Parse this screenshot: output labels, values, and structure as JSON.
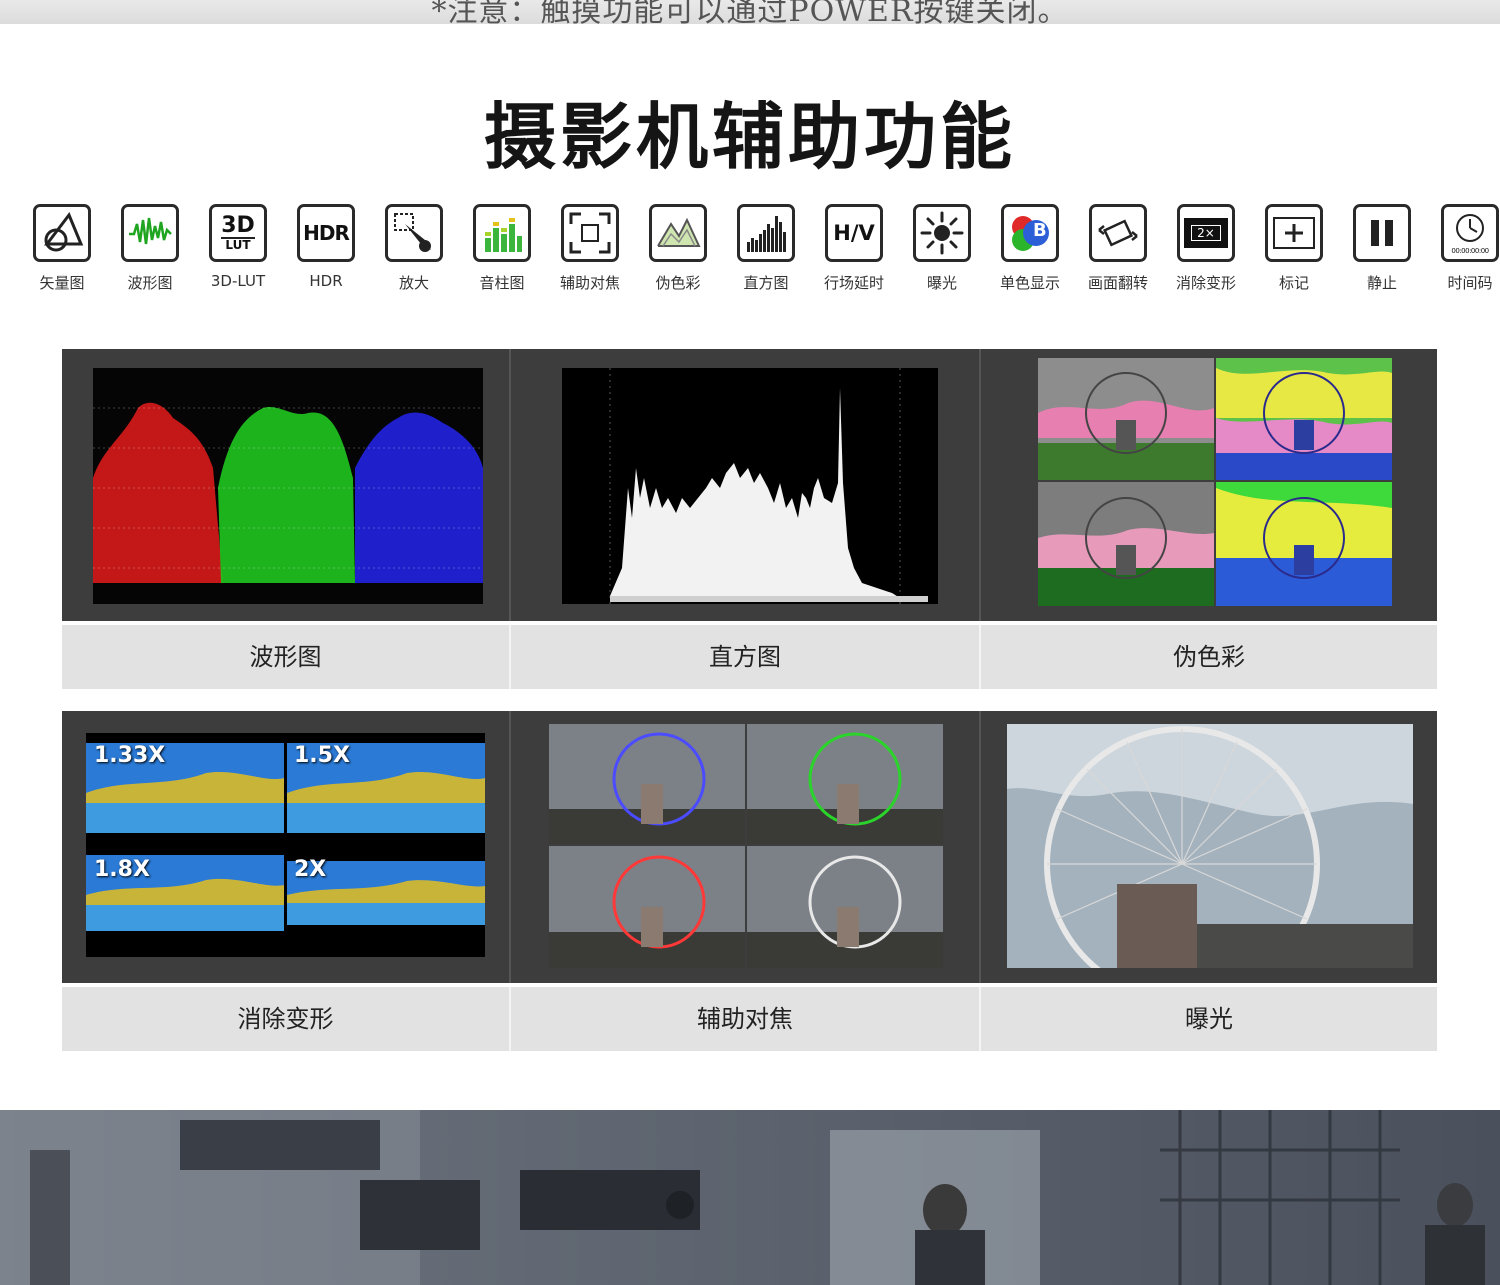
{
  "header": {
    "notice_text": "*注意：触摸功能可以通过POWER按键关闭。",
    "title": "摄影机辅助功能"
  },
  "features": [
    {
      "label": "矢量图",
      "icon": "vectorscope-icon"
    },
    {
      "label": "波形图",
      "icon": "waveform-icon"
    },
    {
      "label": "3D-LUT",
      "icon": "3d-lut-icon",
      "badge_top": "3D",
      "badge_bottom": "LUT"
    },
    {
      "label": "HDR",
      "icon": "hdr-icon",
      "badge_top": "HDR"
    },
    {
      "label": "放大",
      "icon": "zoom-icon"
    },
    {
      "label": "音柱图",
      "icon": "audio-meter-icon"
    },
    {
      "label": "辅助对焦",
      "icon": "focus-assist-icon"
    },
    {
      "label": "伪色彩",
      "icon": "false-color-icon"
    },
    {
      "label": "直方图",
      "icon": "histogram-icon"
    },
    {
      "label": "行场延时",
      "icon": "hv-delay-icon",
      "badge_top": "H/V"
    },
    {
      "label": "曝光",
      "icon": "exposure-icon"
    },
    {
      "label": "单色显示",
      "icon": "mono-color-icon",
      "badge_top": "B"
    },
    {
      "label": "画面翻转",
      "icon": "image-flip-icon"
    },
    {
      "label": "消除变形",
      "icon": "de-squeeze-icon",
      "badge_top": "2×"
    },
    {
      "label": "标记",
      "icon": "marker-icon"
    },
    {
      "label": "静止",
      "icon": "freeze-icon"
    },
    {
      "label": "时间码",
      "icon": "timecode-icon",
      "badge_top": "00:00:00:00"
    }
  ],
  "gallery": {
    "top": [
      {
        "caption": "波形图"
      },
      {
        "caption": "直方图"
      },
      {
        "caption": "伪色彩"
      }
    ],
    "bottom": [
      {
        "caption": "消除变形",
        "zoom_levels": [
          "1.33X",
          "1.5X",
          "1.8X",
          "2X"
        ]
      },
      {
        "caption": "辅助对焦"
      },
      {
        "caption": "曝光"
      }
    ]
  },
  "colors": {
    "panel_bg": "#3d3d3d",
    "caption_bg": "#e2e2e2",
    "icon_stroke": "#2a2a2a",
    "wave_red": "#e01818",
    "wave_green": "#22c81e",
    "wave_blue": "#2a2ae6"
  }
}
